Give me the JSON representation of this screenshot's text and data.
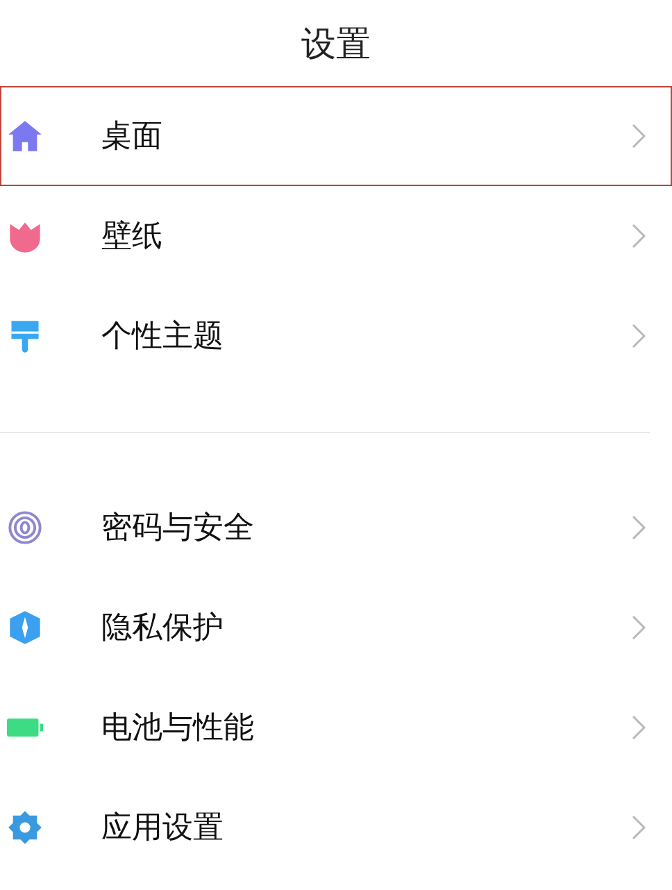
{
  "title": "设置",
  "groups": [
    {
      "items": [
        {
          "label": "桌面",
          "kind": "house",
          "selected": true
        },
        {
          "label": "壁纸",
          "kind": "tulip",
          "selected": false
        },
        {
          "label": "个性主题",
          "kind": "brush",
          "selected": false
        }
      ]
    },
    {
      "items": [
        {
          "label": "密码与安全",
          "kind": "fingerprint",
          "selected": false
        },
        {
          "label": "隐私保护",
          "kind": "shield",
          "selected": false
        },
        {
          "label": "电池与性能",
          "kind": "battery",
          "selected": false
        },
        {
          "label": "应用设置",
          "kind": "gear",
          "selected": false
        }
      ]
    }
  ]
}
